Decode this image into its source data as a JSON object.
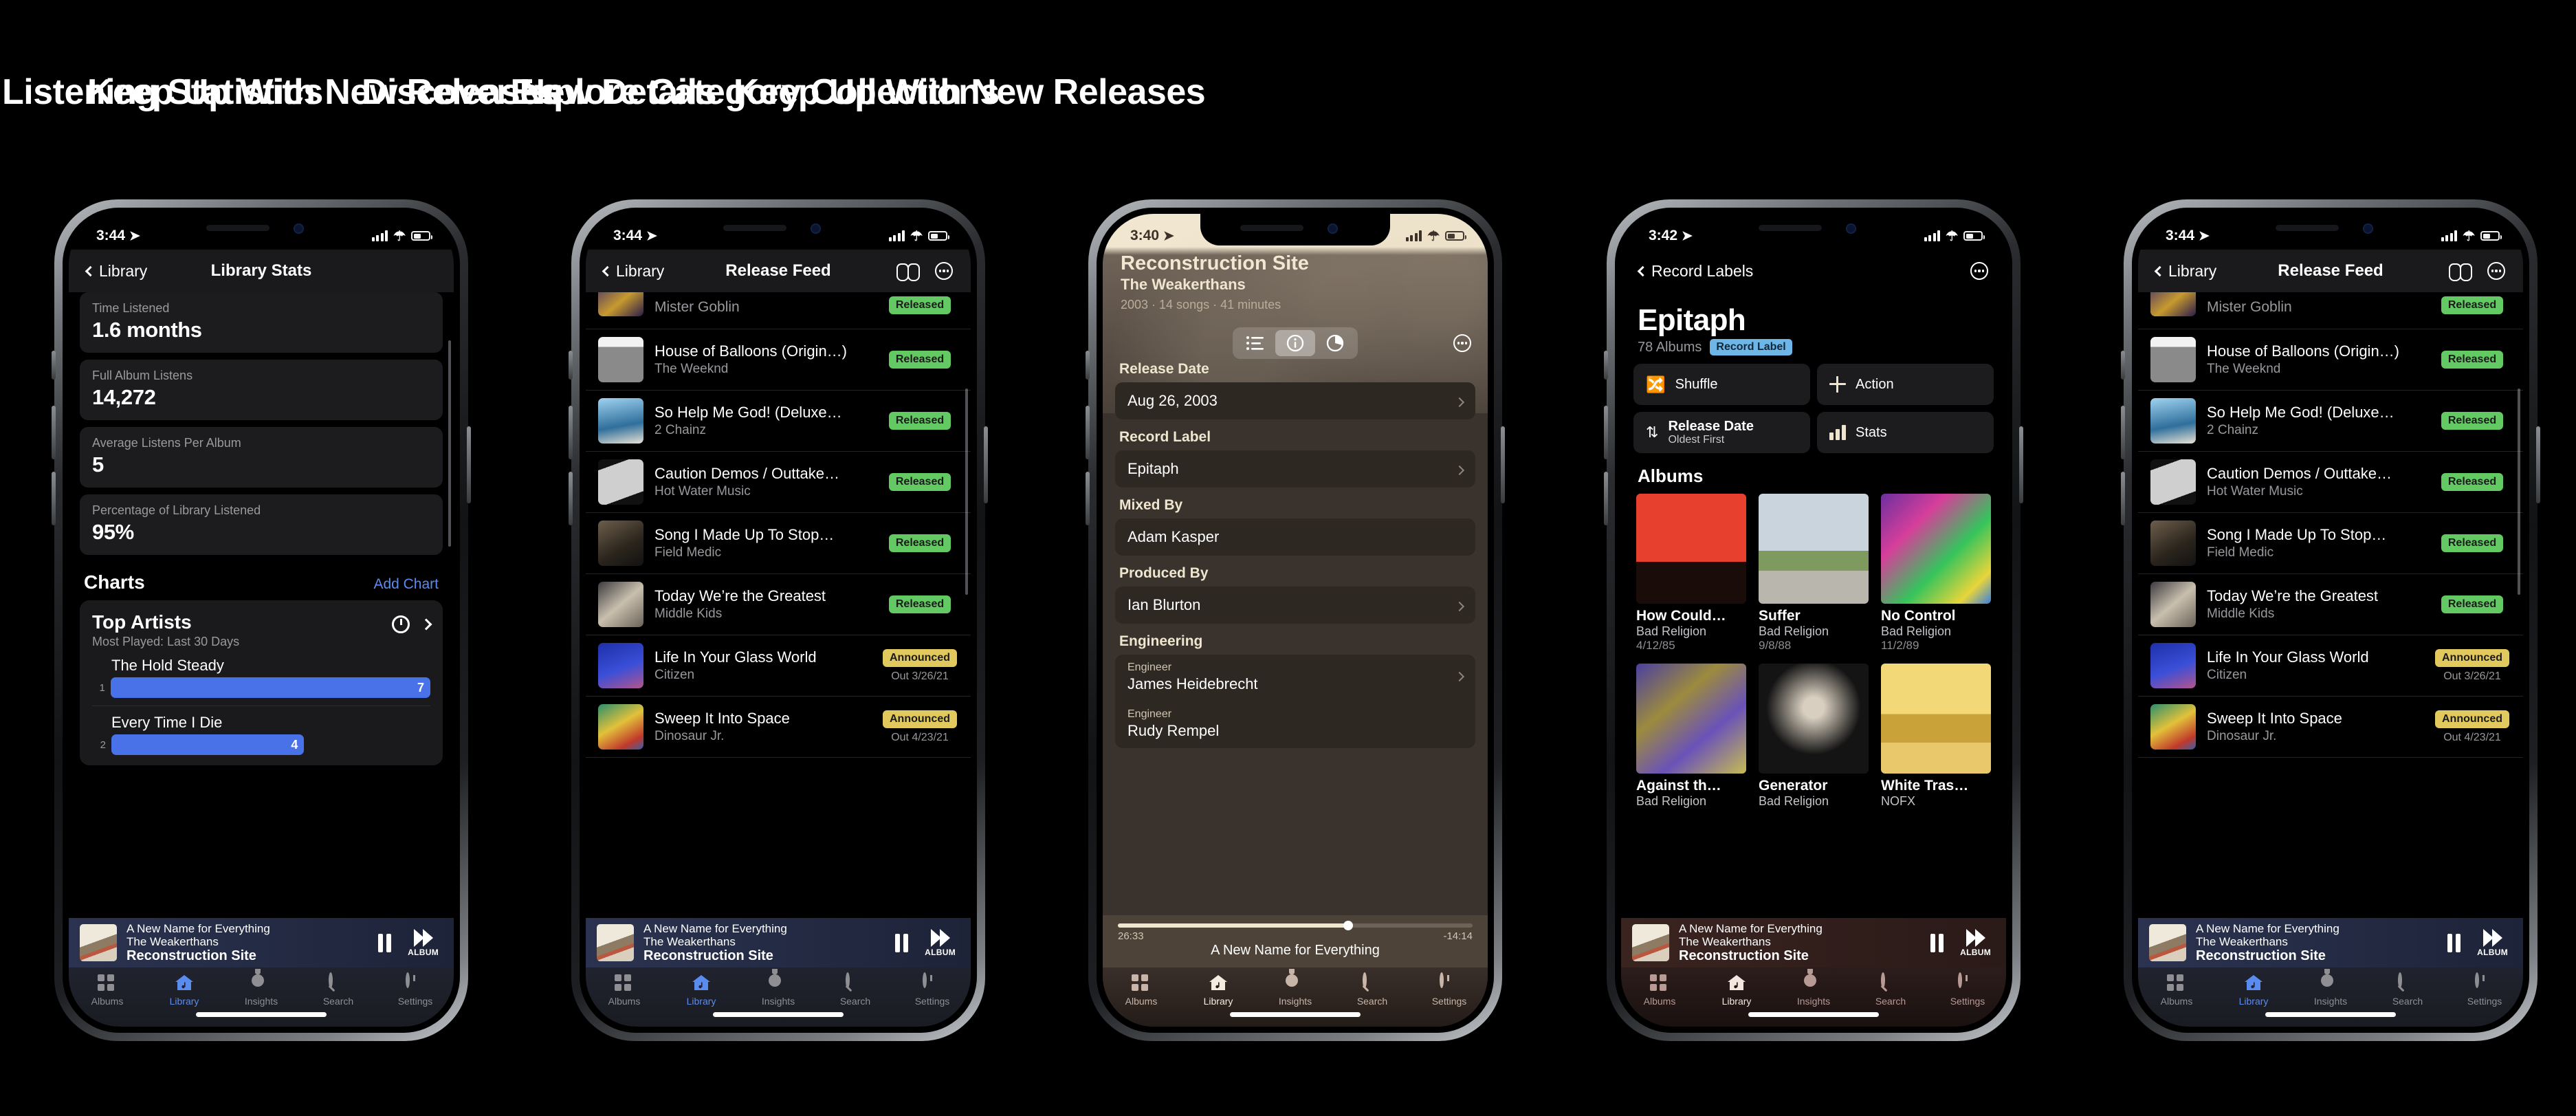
{
  "headings": [
    "Scour Listening Statistics",
    "Keep Up With New Releases",
    "Discover New Details",
    "Explore Category Collections",
    "Keep Up With New Releases"
  ],
  "colors": {
    "accent_blue": "#5a8cf0",
    "badge_released": "#63c963",
    "badge_announced": "#e2c95d",
    "bar_fill": "#4a72e8",
    "tag_blue": "#6fb6e8",
    "cream": "#f1e6cf"
  },
  "tabbar": {
    "items": [
      {
        "label": "Albums",
        "icon": "grid-icon"
      },
      {
        "label": "Library",
        "icon": "home-music-icon"
      },
      {
        "label": "Insights",
        "icon": "lightbulb-icon"
      },
      {
        "label": "Search",
        "icon": "search-icon"
      },
      {
        "label": "Settings",
        "icon": "gear-icon"
      }
    ],
    "active": "Library"
  },
  "now_playing": {
    "track": "A New Name for Everything",
    "artist": "The Weakerthans",
    "album": "Reconstruction Site",
    "pause_label": "pause-icon",
    "next_label": "ALBUM"
  },
  "phone1": {
    "status": {
      "time": "3:44",
      "location_icon": "location-arrow-icon",
      "cellular": "signal-bars-icon",
      "wifi": "wifi-icon",
      "battery": "battery-icon"
    },
    "nav": {
      "back": "Library",
      "title": "Library Stats"
    },
    "stats": [
      {
        "label": "Time Listened",
        "value": "1.6 months"
      },
      {
        "label": "Full Album Listens",
        "value": "14,272"
      },
      {
        "label": "Average Listens Per Album",
        "value": "5"
      },
      {
        "label": "Percentage of Library Listened",
        "value": "95%"
      }
    ],
    "charts_section": {
      "title": "Charts",
      "action": "Add Chart"
    },
    "chart_data": {
      "type": "bar",
      "title": "Top Artists",
      "subtitle": "Most Played: Last 30 Days",
      "orientation": "horizontal",
      "categories": [
        "The Hold Steady",
        "Every Time I Die"
      ],
      "values": [
        7,
        4
      ],
      "ranks": [
        "1",
        "2"
      ],
      "xlabel": "",
      "ylabel": "",
      "xlim": [
        0,
        7
      ],
      "grid": false,
      "legend": false
    }
  },
  "phone2": {
    "status": {
      "time": "3:44"
    },
    "nav": {
      "back": "Library",
      "title": "Release Feed",
      "binoculars": "binoculars-icon",
      "more": "more-dots-icon"
    },
    "rows": [
      {
        "title": "",
        "artist": "Mister Goblin",
        "badge": "Released",
        "badge_type": "rel",
        "out": ""
      },
      {
        "title": "House of Balloons (Origin…)",
        "artist": "The Weeknd",
        "badge": "Released",
        "badge_type": "rel",
        "out": ""
      },
      {
        "title": "So Help Me God! (Deluxe…",
        "artist": "2 Chainz",
        "badge": "Released",
        "badge_type": "rel",
        "out": ""
      },
      {
        "title": "Caution Demos / Outtake…",
        "artist": "Hot Water Music",
        "badge": "Released",
        "badge_type": "rel",
        "out": ""
      },
      {
        "title": "Song I Made Up To Stop…",
        "artist": "Field Medic",
        "badge": "Released",
        "badge_type": "rel",
        "out": ""
      },
      {
        "title": "Today We’re the Greatest",
        "artist": "Middle Kids",
        "badge": "Released",
        "badge_type": "rel",
        "out": ""
      },
      {
        "title": "Life In Your Glass World",
        "artist": "Citizen",
        "badge": "Announced",
        "badge_type": "ann",
        "out": "Out 3/26/21"
      },
      {
        "title": "Sweep It Into Space",
        "artist": "Dinosaur Jr.",
        "badge": "Announced",
        "badge_type": "ann",
        "out": "Out 4/23/21"
      }
    ]
  },
  "phone3": {
    "status": {
      "time": "3:40"
    },
    "hero": {
      "album": "Reconstruction Site",
      "artist": "The Weakerthans",
      "meta": "2003 · 14 songs · 41 minutes"
    },
    "segments": [
      {
        "icon": "tracklist-icon",
        "active": false
      },
      {
        "icon": "info-circle-icon",
        "active": true
      },
      {
        "icon": "pie-chart-icon",
        "active": false
      }
    ],
    "more": "more-dots-icon",
    "fields": [
      {
        "label": "Release Date",
        "value": "Aug 26, 2003",
        "chevron": true
      },
      {
        "label": "Record Label",
        "value": "Epitaph",
        "chevron": true
      },
      {
        "label": "Mixed By",
        "value": "Adam Kasper",
        "chevron": false
      },
      {
        "label": "Produced By",
        "value": "Ian Blurton",
        "chevron": true
      }
    ],
    "engineering": {
      "label": "Engineering",
      "entries": [
        {
          "role": "Engineer",
          "name": "James Heidebrecht",
          "chevron": true
        },
        {
          "role": "Engineer",
          "name": "Rudy Rempel",
          "chevron": false
        }
      ]
    },
    "player": {
      "elapsed": "26:33",
      "remaining": "-14:14",
      "title": "A New Name for Everything",
      "progress_percent": 65
    }
  },
  "phone4": {
    "status": {
      "time": "3:42"
    },
    "nav": {
      "back": "Record Labels",
      "more": "more-dots-icon"
    },
    "title": "Epitaph",
    "album_count": "78 Albums",
    "tag": "Record Label",
    "actions": [
      {
        "icon": "shuffle-icon",
        "label": "Shuffle",
        "sub": ""
      },
      {
        "icon": "plus-icon",
        "label": "Action",
        "sub": ""
      },
      {
        "icon": "sort-icon",
        "label": "Release Date",
        "sub": "Oldest First"
      },
      {
        "icon": "bar-stats-icon",
        "label": "Stats",
        "sub": ""
      }
    ],
    "albums_section": "Albums",
    "albums": [
      {
        "title": "How Could…",
        "artist": "Bad Religion",
        "date": "4/12/85",
        "cover": "red-city"
      },
      {
        "title": "Suffer",
        "artist": "Bad Religion",
        "date": "9/8/88",
        "cover": "suburb"
      },
      {
        "title": "No Control",
        "artist": "Bad Religion",
        "date": "11/2/89",
        "cover": "neon-text"
      },
      {
        "title": "Against th…",
        "artist": "Bad Religion",
        "date": "",
        "cover": "flowers"
      },
      {
        "title": "Generator",
        "artist": "Bad Religion",
        "date": "",
        "cover": "dark-hand"
      },
      {
        "title": "White Tras…",
        "artist": "NOFX",
        "date": "",
        "cover": "yellow-shirts"
      }
    ]
  },
  "phone5": {
    "status": {
      "time": "3:44"
    },
    "nav": {
      "back": "Library",
      "title": "Release Feed",
      "binoculars": "binoculars-icon",
      "more": "more-dots-icon"
    }
  }
}
